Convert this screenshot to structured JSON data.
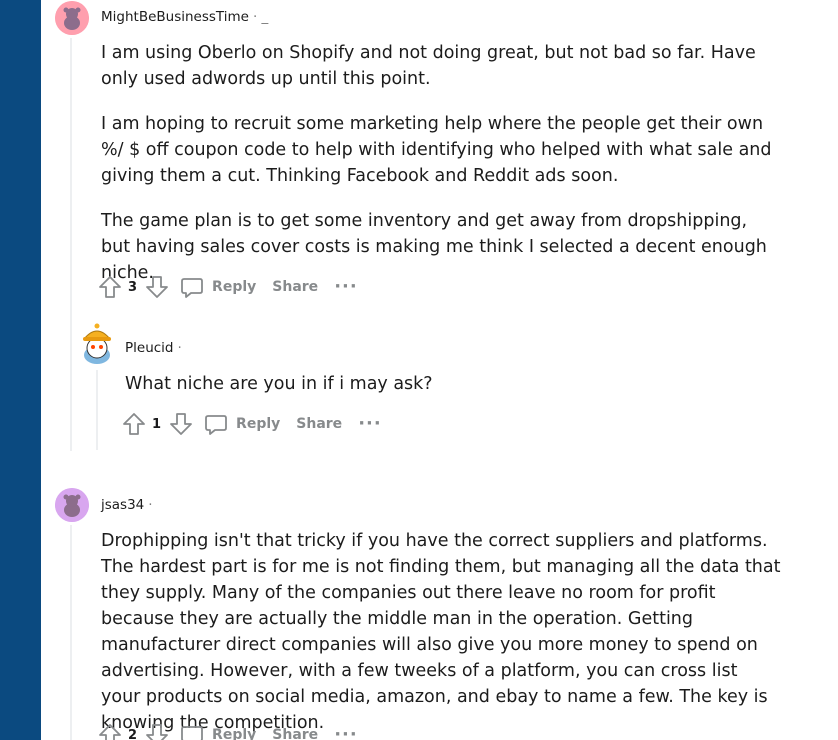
{
  "comments": [
    {
      "username": "MightBeBusinessTime",
      "meta": "· _",
      "paragraphs": [
        "I am using Oberlo on Shopify and not doing great, but not bad so far. Have only used adwords up until this point.",
        "I am hoping to recruit some marketing help where the people get their own %/ $ off coupon code to help with identifying who helped with what sale and giving them a cut. Thinking Facebook and Reddit ads soon.",
        "The game plan is to get some inventory and get away from dropshipping, but having sales cover costs is making me think I selected a decent enough niche."
      ],
      "votes": "3",
      "reply_label": "Reply",
      "share_label": "Share",
      "more_label": "···"
    },
    {
      "username": "Pleucid",
      "meta": "·",
      "paragraphs": [
        "What niche are you in if i may ask?"
      ],
      "votes": "1",
      "reply_label": "Reply",
      "share_label": "Share",
      "more_label": "···"
    },
    {
      "username": "jsas34",
      "meta": "·",
      "paragraphs": [
        "Drophipping isn't that tricky if you have the correct suppliers and platforms. The hardest part is for me is not finding them, but managing all the data that they supply. Many of the companies out there leave no room for profit because they are actually the middle man in the operation. Getting manufacturer direct companies will also give you more money to spend on advertising. However, with a few tweeks of a platform, you can cross list your products on social media, amazon, and ebay to name a few. The key is knowing the competition."
      ],
      "votes": "2",
      "reply_label": "Reply",
      "share_label": "Share",
      "more_label": "···"
    }
  ],
  "colors": {
    "sidebar": "#0b4a80",
    "avatar_pink": "#ff9fae",
    "avatar_purple": "#d8a6ef",
    "text": "#1c1c1c",
    "muted": "#878a8c"
  }
}
